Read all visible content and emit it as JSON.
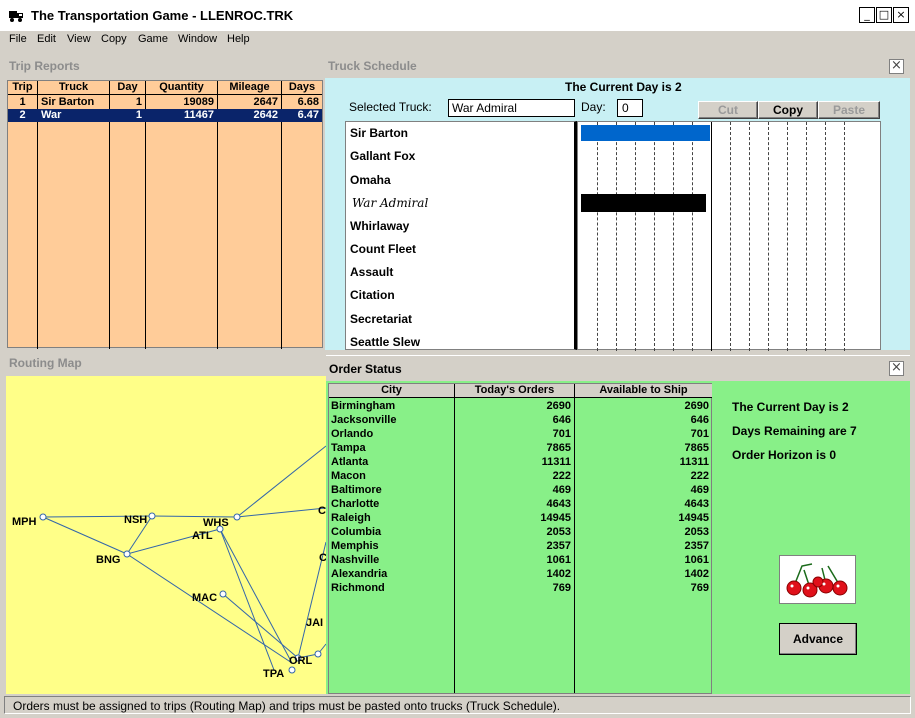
{
  "window": {
    "title": "The Transportation Game - LLENROC.TRK"
  },
  "menu": [
    "File",
    "Edit",
    "View",
    "Copy",
    "Game",
    "Window",
    "Help"
  ],
  "trip_reports": {
    "title": "Trip Reports",
    "columns": [
      "Trip",
      "Truck",
      "Day",
      "Quantity",
      "Mileage",
      "Days"
    ],
    "rows": [
      {
        "trip": "1",
        "truck": "Sir Barton",
        "day": "1",
        "quantity": "19089",
        "mileage": "2647",
        "days": "6.68"
      },
      {
        "trip": "2",
        "truck": "War",
        "day": "1",
        "quantity": "11467",
        "mileage": "2642",
        "days": "6.47"
      }
    ],
    "selected_row": 1
  },
  "truck_schedule": {
    "title": "Truck Schedule",
    "current_day": "The Current Day is 2",
    "selected_truck_label": "Selected Truck:",
    "selected_truck": "War Admiral",
    "day_label": "Day:",
    "day_value": "0",
    "cut": "Cut",
    "copy": "Copy",
    "paste": "Paste",
    "trucks": [
      "Sir Barton",
      "Gallant Fox",
      "Omaha",
      "War Admiral",
      "Whirlaway",
      "Count Fleet",
      "Assault",
      "Citation",
      "Secretariat",
      "Seattle Slew"
    ]
  },
  "routing_map": {
    "title": "Routing Map",
    "nodes": [
      "MPH",
      "NSH",
      "WHS",
      "ATL",
      "BNG",
      "MAC",
      "TPA",
      "ORL",
      "JAI",
      "C",
      "C"
    ]
  },
  "order_status": {
    "title": "Order Status",
    "columns": [
      "City",
      "Today's Orders",
      "Available to Ship"
    ],
    "rows": [
      {
        "city": "Birmingham",
        "today": "2690",
        "avail": "2690"
      },
      {
        "city": "Jacksonville",
        "today": "646",
        "avail": "646"
      },
      {
        "city": "Orlando",
        "today": "701",
        "avail": "701"
      },
      {
        "city": "Tampa",
        "today": "7865",
        "avail": "7865"
      },
      {
        "city": "Atlanta",
        "today": "11311",
        "avail": "11311"
      },
      {
        "city": "Macon",
        "today": "222",
        "avail": "222"
      },
      {
        "city": "Baltimore",
        "today": "469",
        "avail": "469"
      },
      {
        "city": "Charlotte",
        "today": "4643",
        "avail": "4643"
      },
      {
        "city": "Raleigh",
        "today": "14945",
        "avail": "14945"
      },
      {
        "city": "Columbia",
        "today": "2053",
        "avail": "2053"
      },
      {
        "city": "Memphis",
        "today": "2357",
        "avail": "2357"
      },
      {
        "city": "Nashville",
        "today": "1061",
        "avail": "1061"
      },
      {
        "city": "Alexandria",
        "today": "1402",
        "avail": "1402"
      },
      {
        "city": "Richmond",
        "today": "769",
        "avail": "769"
      }
    ],
    "current_day": "The Current Day is 2",
    "days_remaining": "Days Remaining are 7",
    "order_horizon": "Order Horizon is 0",
    "advance": "Advance"
  },
  "status_bar": "Orders must be assigned to trips (Routing Map) and trips must be pasted onto trucks (Truck Schedule)."
}
